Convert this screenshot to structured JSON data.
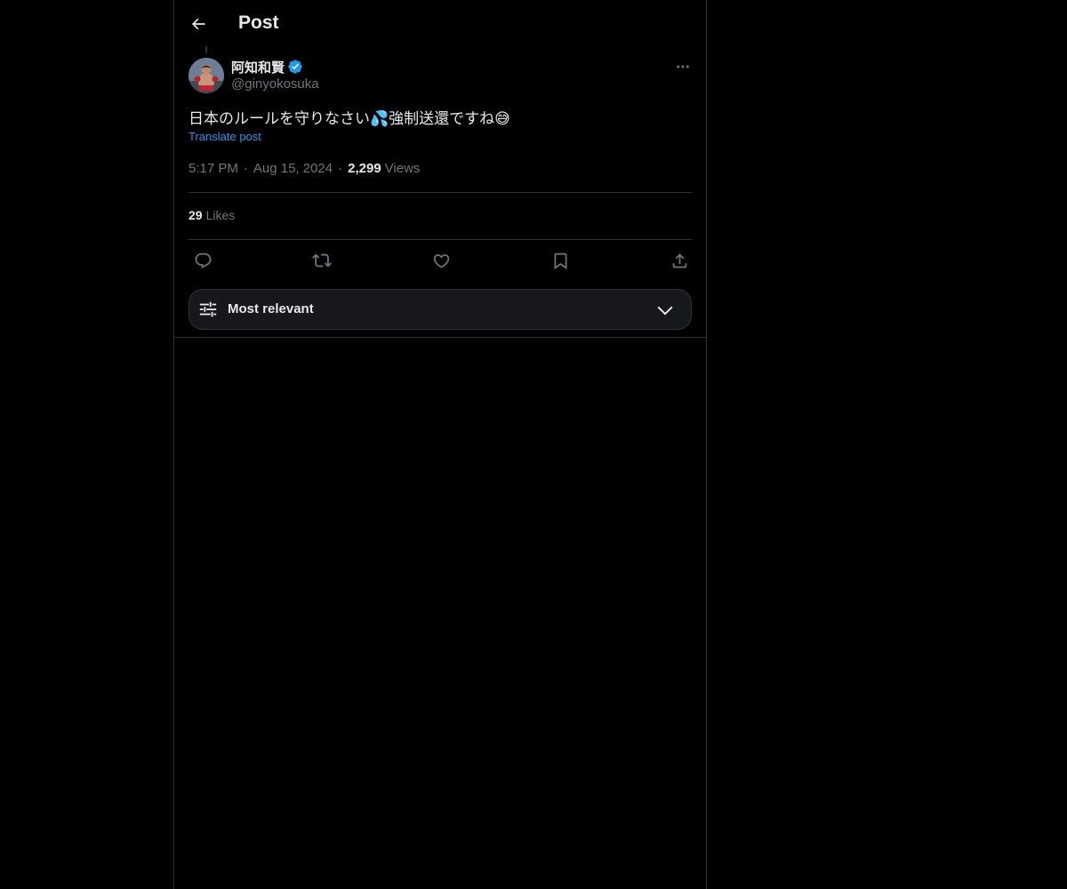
{
  "header": {
    "back_icon": "arrow-left-icon",
    "title": "Post"
  },
  "post": {
    "author": {
      "display_name": "阿知和賢",
      "handle": "@ginyokosuka",
      "verified": true,
      "verified_color": "#1d9bf0"
    },
    "text": "日本のルールを守りなさい💦強制送還ですね😅",
    "translate_label": "Translate post",
    "time": "5:17 PM",
    "date": "Aug 15, 2024",
    "views_count": "2,299",
    "views_label": "Views",
    "separator": "·",
    "likes_count": "29",
    "likes_label": "Likes"
  },
  "actions": [
    {
      "name": "reply",
      "icon": "reply-icon"
    },
    {
      "name": "repost",
      "icon": "repost-icon"
    },
    {
      "name": "like",
      "icon": "heart-icon"
    },
    {
      "name": "bookmark",
      "icon": "bookmark-icon"
    },
    {
      "name": "share",
      "icon": "share-icon"
    }
  ],
  "replies_sort": {
    "icon": "sliders-icon",
    "label": "Most relevant",
    "chevron": "chevron-down-icon"
  },
  "colors": {
    "background": "#000000",
    "text": "#e7e9ea",
    "secondary_text": "#71767b",
    "accent": "#1d9bf0",
    "border": "#2f3336"
  }
}
